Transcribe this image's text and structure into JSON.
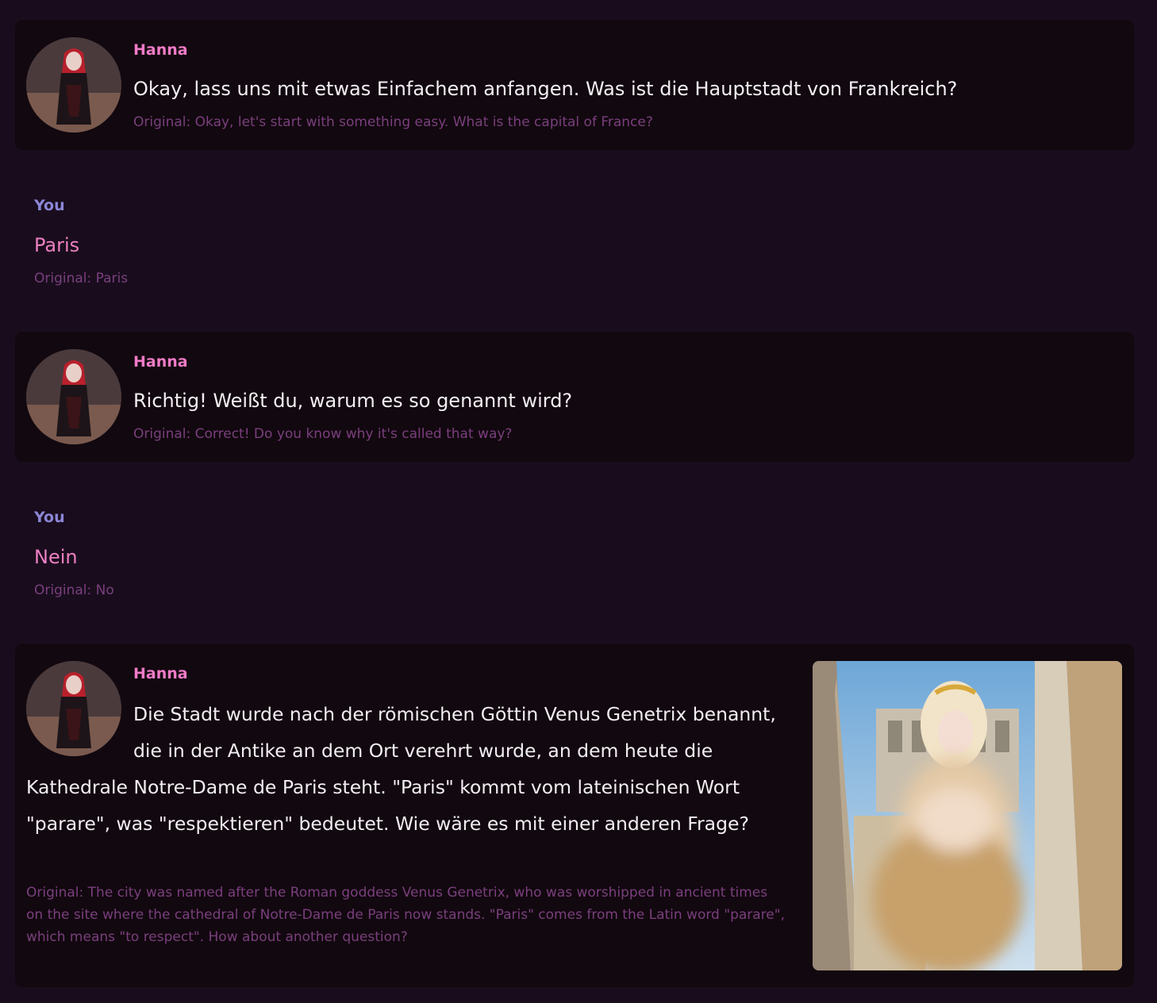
{
  "messages": [
    {
      "speaker": "Hanna",
      "text": "Okay, lass uns mit etwas Einfachem anfangen. Was ist die Hauptstadt von Frankreich?",
      "original": "Original: Okay, let's start with something easy. What is the capital of France?"
    },
    {
      "speaker": "You",
      "text": "Paris",
      "original": "Original: Paris"
    },
    {
      "speaker": "Hanna",
      "text": "Richtig! Weißt du, warum es so genannt wird?",
      "original": "Original: Correct! Do you know why it's called that way?"
    },
    {
      "speaker": "You",
      "text": "Nein",
      "original": "Original: No"
    },
    {
      "speaker": "Hanna",
      "text": "Die Stadt wurde nach der römischen Göttin Venus Genetrix benannt, die in der Antike an dem Ort verehrt wurde, an dem heute die Kathedrale Notre-Dame de Paris steht. \"Paris\" kommt vom lateinischen Wort \"parare\", was \"respektieren\" bedeutet. Wie wäre es mit einer anderen Frage?",
      "original": "Original: The city was named after the Roman goddess Venus Genetrix, who was worshipped in ancient times on the site where the cathedral of Notre-Dame de Paris now stands. \"Paris\" comes from the Latin word \"parare\", which means \"to respect\". How about another question?"
    }
  ],
  "colors": {
    "page_background": "#190d1d",
    "bot_card_background": "#12080f",
    "bot_name": "#f07bc7",
    "user_name": "#8b86d6",
    "user_text": "#ee7fc2",
    "original_text": "#7a3f7e",
    "message_text": "#f2eef2"
  }
}
